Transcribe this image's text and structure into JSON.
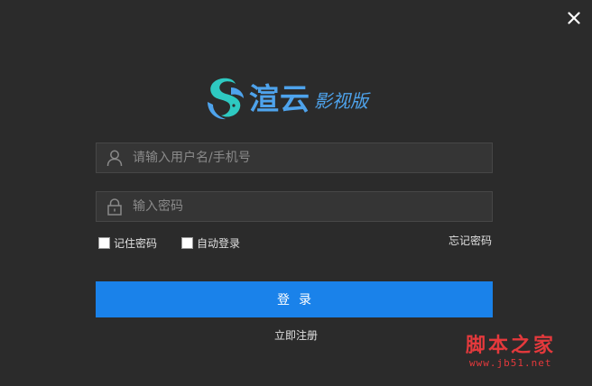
{
  "app": {
    "name": "渲云",
    "subtitle": "影视版"
  },
  "login": {
    "username_placeholder": "请输入用户名/手机号",
    "username_value": "",
    "password_placeholder": "输入密码",
    "password_value": "",
    "remember_label": "记住密码",
    "remember_checked": false,
    "auto_login_label": "自动登录",
    "auto_login_checked": false,
    "forgot_label": "忘记密码",
    "submit_label": "登录",
    "register_label": "立即注册"
  },
  "watermark": {
    "title": "脚本之家",
    "url": "www.jb51.net"
  },
  "colors": {
    "background": "#2b2b2b",
    "field_bg": "#353535",
    "accent": "#1a82ea",
    "logo_blue": "#4ea3ec",
    "logo_teal": "#2ec9c1",
    "watermark_red": "#e4393c"
  },
  "icons": {
    "close": "close-icon",
    "user": "user-icon",
    "lock": "lock-icon"
  }
}
